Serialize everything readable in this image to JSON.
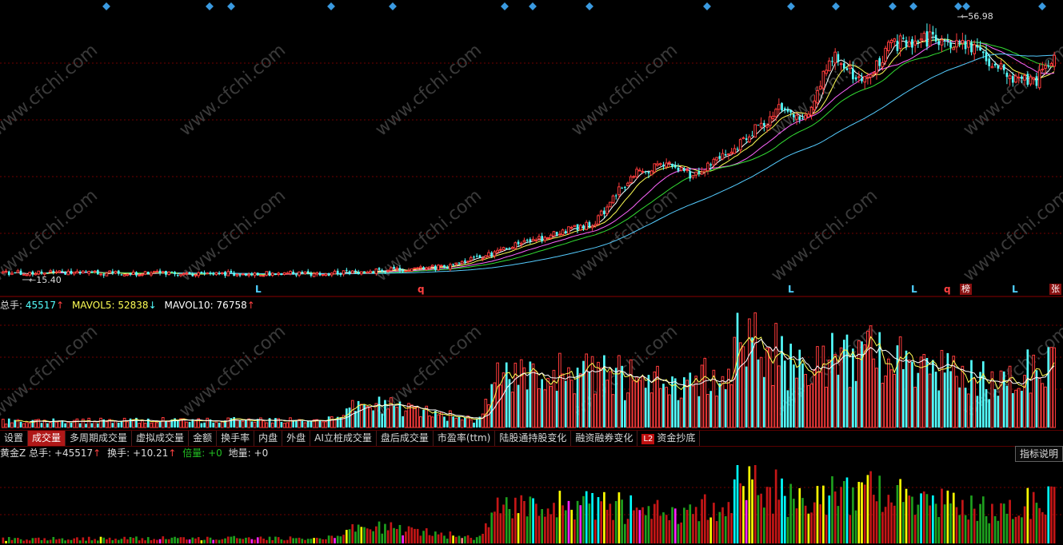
{
  "price_panel": {
    "high_label": "56.98",
    "low_label": "15.40",
    "signals": [
      "L",
      "q",
      "L",
      "L",
      "q",
      "L"
    ],
    "badges": [
      "榜",
      "张"
    ]
  },
  "volume_legend": {
    "total_label": "总手:",
    "total_value": "45517",
    "total_arrow": "↑",
    "mavol5_label": "MAVOL5:",
    "mavol5_value": "52838",
    "mavol5_arrow": "↓",
    "mavol10_label": "MAVOL10:",
    "mavol10_value": "76758",
    "mavol10_arrow": "↑"
  },
  "tabs": [
    {
      "label": "设置",
      "active": false
    },
    {
      "label": "成交量",
      "active": true
    },
    {
      "label": "多周期成交量",
      "active": false
    },
    {
      "label": "虚拟成交量",
      "active": false
    },
    {
      "label": "金额",
      "active": false
    },
    {
      "label": "换手率",
      "active": false
    },
    {
      "label": "内盘",
      "active": false
    },
    {
      "label": "外盘",
      "active": false
    },
    {
      "label": "AI立桩成交量",
      "active": false
    },
    {
      "label": "盘后成交量",
      "active": false
    },
    {
      "label": "市盈率(ttm)",
      "active": false
    },
    {
      "label": "陆股通持股变化",
      "active": false
    },
    {
      "label": "融资融券变化",
      "active": false
    },
    {
      "label": "资金抄底",
      "active": false,
      "badge": "L2"
    }
  ],
  "z_legend": {
    "name": "黄金Z",
    "total_label": "总手:",
    "total_value": "+45517",
    "total_arrow": "↑",
    "turnover_label": "换手:",
    "turnover_value": "+10.21",
    "turnover_arrow": "↑",
    "ratio_label": "倍量:",
    "ratio_value": "+0",
    "ground_label": "地量:",
    "ground_value": "+0"
  },
  "indicator_help_label": "指标说明",
  "watermark": "www.cfchi.com",
  "colors": {
    "up": "#ff3c3c",
    "down": "#54ffff",
    "grid": "#700000",
    "ma5": "#ffffff",
    "ma10": "#ffff55",
    "ma20": "#ff66ff",
    "ma30": "#33dd33",
    "ma60": "#55ccff",
    "diamond": "#3a9ae0",
    "z_green": "#1ea01e",
    "z_red": "#c41616",
    "z_yellow": "#ffff00",
    "z_cyan": "#00ffff",
    "z_magenta": "#ff22ff",
    "z_pink": "#ff7f7f"
  },
  "chart_data": {
    "type": "candlestick",
    "title": "",
    "price_range": [
      15.4,
      56.98
    ],
    "days": 260,
    "price_anchors": [
      [
        0,
        16.3
      ],
      [
        30,
        16.2
      ],
      [
        60,
        16.1
      ],
      [
        100,
        16.1
      ],
      [
        120,
        16.3
      ],
      [
        140,
        17.0
      ],
      [
        150,
        17.2
      ],
      [
        160,
        18.6
      ],
      [
        175,
        21.0
      ],
      [
        185,
        22.3
      ],
      [
        200,
        24.5
      ],
      [
        212,
        31.5
      ],
      [
        222,
        34.0
      ],
      [
        232,
        32.0
      ],
      [
        246,
        36.0
      ],
      [
        262,
        42.5
      ],
      [
        270,
        40.5
      ],
      [
        280,
        51.5
      ],
      [
        290,
        47.5
      ],
      [
        300,
        53.0
      ],
      [
        310,
        54.0
      ],
      [
        320,
        53.8
      ],
      [
        330,
        52.0
      ],
      [
        340,
        48.0
      ],
      [
        349,
        47.5
      ],
      [
        355,
        50.5
      ]
    ],
    "volume_anchors": [
      [
        0,
        5000
      ],
      [
        100,
        6000
      ],
      [
        114,
        6500
      ],
      [
        116,
        22000
      ],
      [
        160,
        6000
      ],
      [
        168,
        40000
      ],
      [
        200,
        42000
      ],
      [
        220,
        36000
      ],
      [
        240,
        40000
      ],
      [
        250,
        60000
      ],
      [
        270,
        48000
      ],
      [
        290,
        58000
      ],
      [
        310,
        46000
      ],
      [
        330,
        40000
      ],
      [
        349,
        45517
      ],
      [
        355,
        45000
      ]
    ]
  }
}
